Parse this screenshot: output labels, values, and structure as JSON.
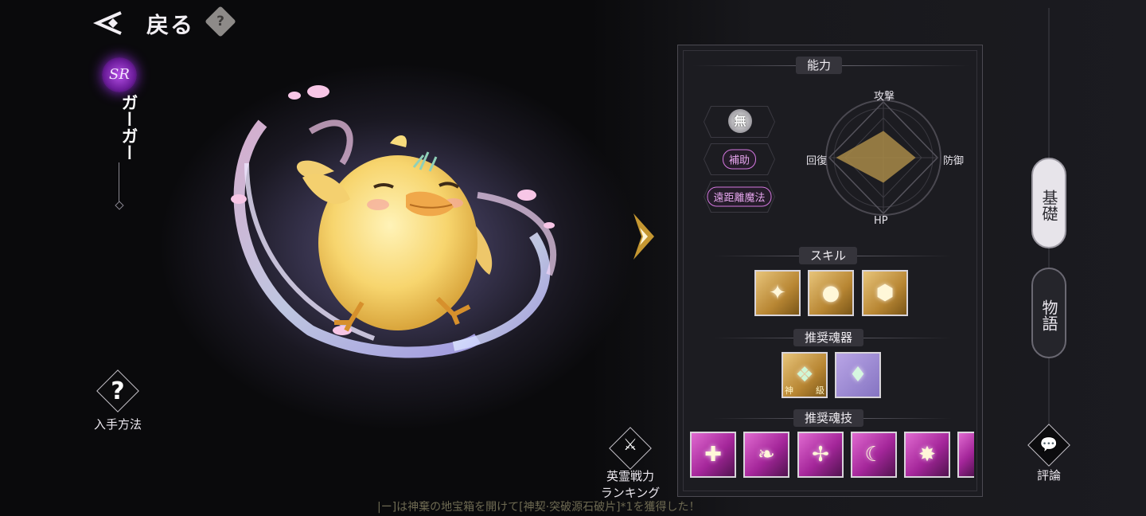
{
  "header": {
    "back_label": "戻る",
    "help_icon": "?"
  },
  "character": {
    "rarity": "SR",
    "name": "ガーガー"
  },
  "left": {
    "obtain_label": "入手方法"
  },
  "ranking": {
    "label_line1": "英霊戦力",
    "label_line2": "ランキング"
  },
  "panel": {
    "ability_title": "能力",
    "element_badge": "無",
    "role_tag": "補助",
    "attack_type_tag": "遠距離魔法",
    "stats": {
      "attack": "攻撃",
      "defense": "防御",
      "hp": "HP",
      "recovery": "回復"
    },
    "stat_values": {
      "attack": 0.48,
      "defense": 0.58,
      "hp": 0.45,
      "recovery": 0.85
    },
    "skill_title": "スキル",
    "skills": [
      "skill-slash-icon",
      "skill-chick-icon",
      "skill-shield-icon"
    ],
    "weapon_title": "推奨魂器",
    "weapon_badges": {
      "left": "神",
      "right": "級"
    },
    "soul_skill_title": "推奨魂技",
    "soul_skills": [
      "heal-plus-icon",
      "feather-icon",
      "plus-wave-icon",
      "moon-icon",
      "burst-icon",
      "partial-icon"
    ]
  },
  "tabs": {
    "basic": "基礎",
    "story": "物語"
  },
  "review_label": "評論",
  "ticker": "|ー]は神棄の地宝箱を開けて[神契·突破源石破片]*1を獲得した！",
  "colors": {
    "accent_gold": "#d9a635",
    "rarity_purple": "#8a2ad0",
    "tag_pink": "#d477e0"
  }
}
